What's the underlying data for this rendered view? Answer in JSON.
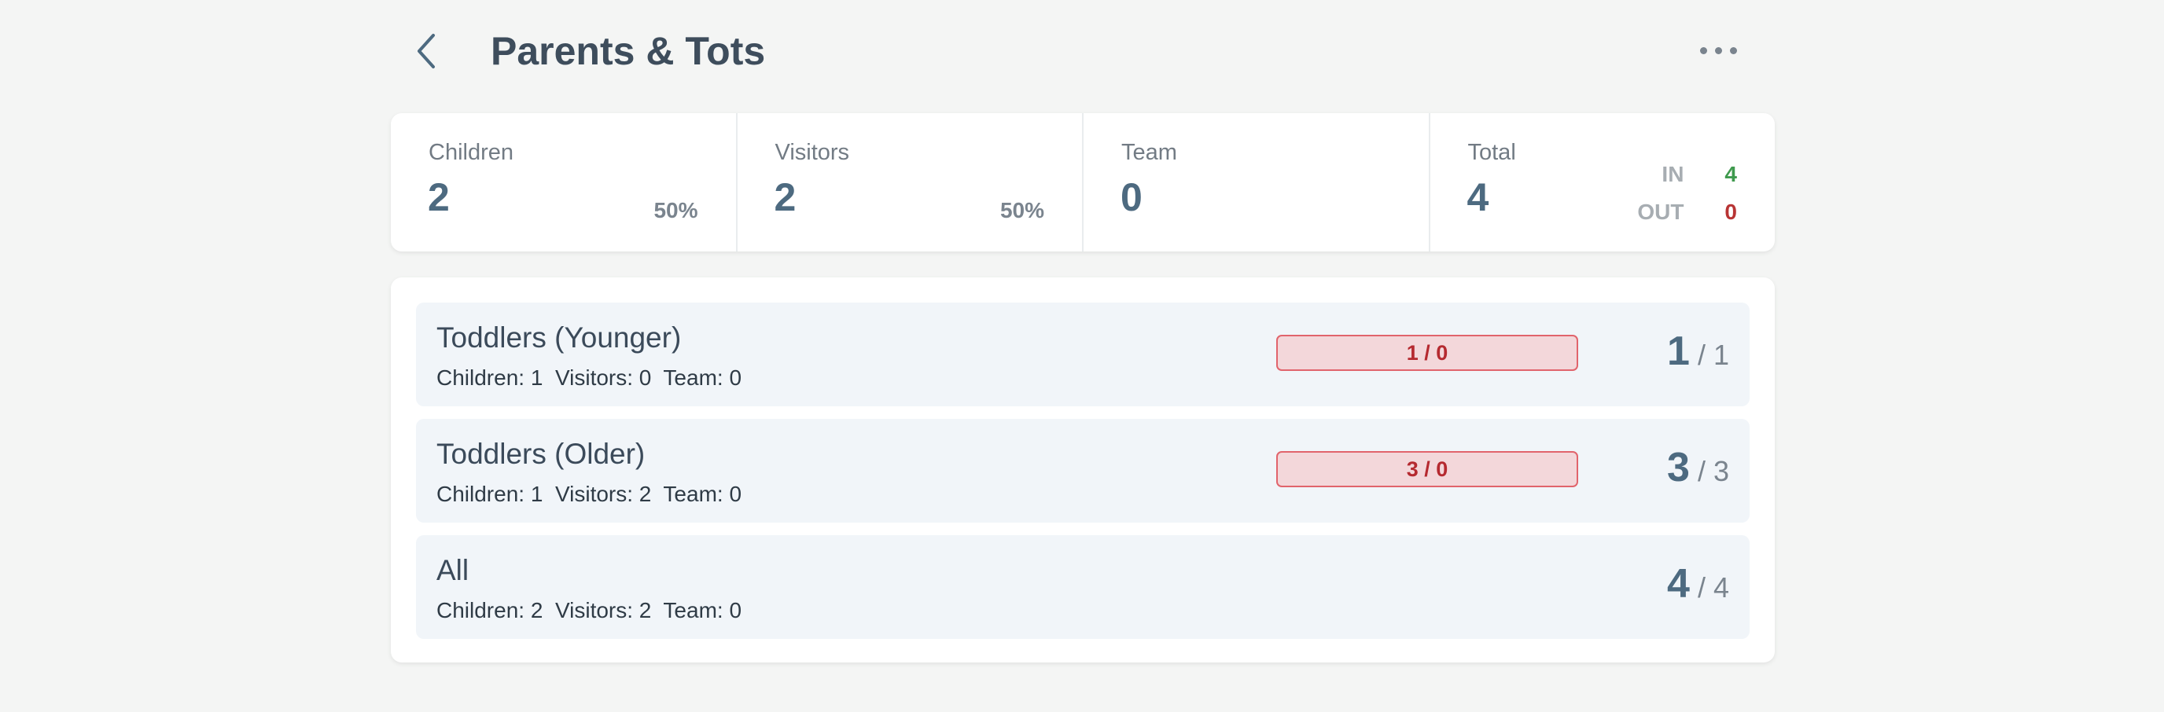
{
  "header": {
    "title": "Parents & Tots"
  },
  "stats": {
    "children": {
      "label": "Children",
      "value": "2",
      "percent": "50%"
    },
    "visitors": {
      "label": "Visitors",
      "value": "2",
      "percent": "50%"
    },
    "team": {
      "label": "Team",
      "value": "0"
    },
    "total": {
      "label": "Total",
      "value": "4",
      "in_label": "IN",
      "in_value": "4",
      "out_label": "OUT",
      "out_value": "0"
    }
  },
  "groups": [
    {
      "name": "Toddlers (Younger)",
      "breakdown": "Children: 1  Visitors: 0  Team: 0",
      "ratio": "1 / 0",
      "count": "1",
      "count_total": "/ 1"
    },
    {
      "name": "Toddlers (Older)",
      "breakdown": "Children: 1  Visitors: 2  Team: 0",
      "ratio": "3 / 0",
      "count": "3",
      "count_total": "/ 3"
    },
    {
      "name": "All",
      "breakdown": "Children: 2  Visitors: 2  Team: 0",
      "count": "4",
      "count_total": "/ 4"
    }
  ],
  "colors": {
    "background": "#f4f5f4",
    "value": "#4d6a80",
    "in": "#3f9a4e",
    "out": "#b83434",
    "badge_bg": "#f3d7da",
    "badge_border": "#e1646c"
  },
  "icons": {
    "back": "chevron-left-icon",
    "more": "more-horizontal-icon"
  }
}
